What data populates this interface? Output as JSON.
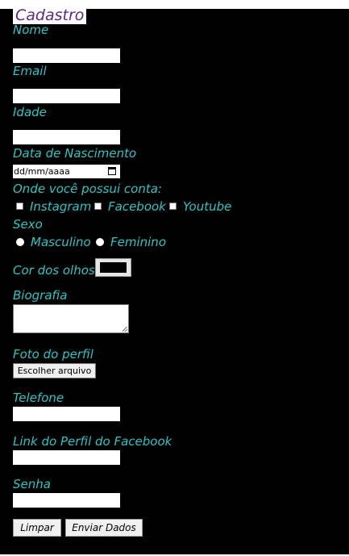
{
  "form": {
    "legend": "Cadastro",
    "nome_label": "Nome",
    "email_label": "Email",
    "idade_label": "Idade",
    "nascimento_label": "Data de Nascimento",
    "date_placeholder": "dd/mm/aaaa",
    "contas_label": "Onde você possui conta:",
    "contas": [
      "Instagram",
      "Facebook",
      "Youtube"
    ],
    "sexo_label": "Sexo",
    "sexo_options": [
      "Masculino",
      "Feminino"
    ],
    "olhos_label": "Cor dos olhos",
    "olhos_color": "#000000",
    "bio_label": "Biografia",
    "foto_label": "Foto do perfil",
    "file_button": "Escolher arquivo",
    "telefone_label": "Telefone",
    "facebook_label": "Link do Perfil do Facebook",
    "senha_label": "Senha",
    "limpar": "Limpar",
    "enviar": "Enviar Dados"
  },
  "colors": {
    "label": "#2ec4c4",
    "legend": "#5b2a86",
    "background": "#000000"
  }
}
